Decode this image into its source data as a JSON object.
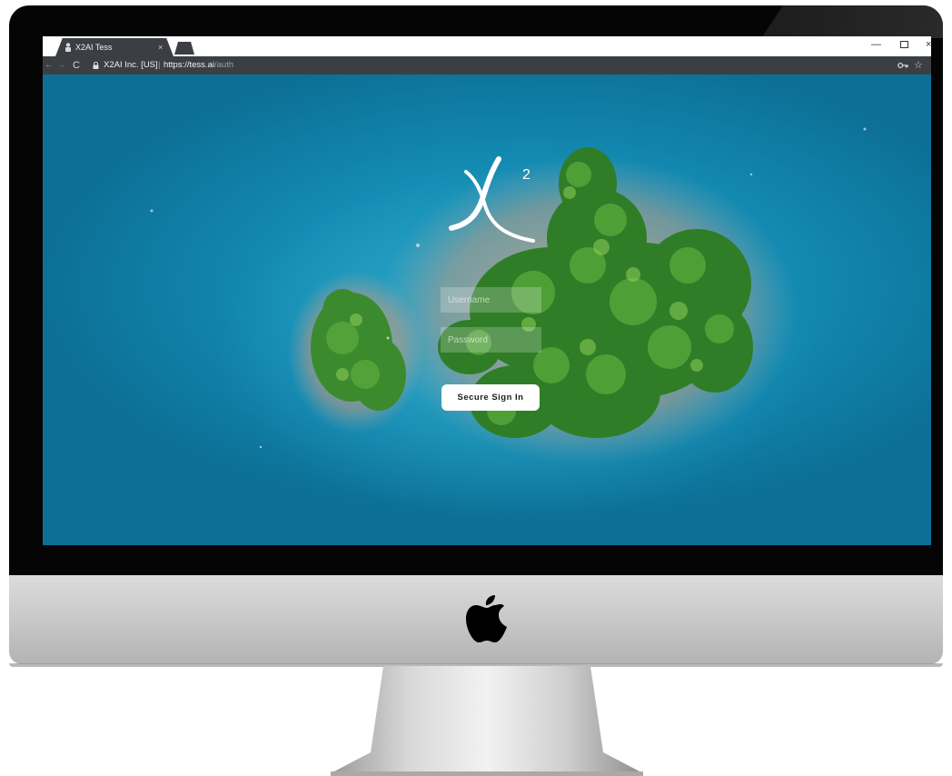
{
  "browser": {
    "tab_title": "X2AI Tess",
    "tab_close": "×",
    "window_minimize": "—",
    "window_close": "×",
    "nav_back": "←",
    "nav_forward": "→",
    "reload": "C",
    "site_identity": "X2AI Inc. [US]",
    "url_separator": "|",
    "url_host": "https://tess.ai",
    "url_path": "/auth",
    "bookmark_star": "☆"
  },
  "login": {
    "logo_letter": "X",
    "logo_superscript": "2",
    "username_placeholder": "Username",
    "password_placeholder": "Password",
    "signin_label": "Secure Sign In"
  },
  "colors": {
    "water": "#168fb6",
    "browser_chrome": "#3b3f44",
    "button": "#ffffff"
  }
}
